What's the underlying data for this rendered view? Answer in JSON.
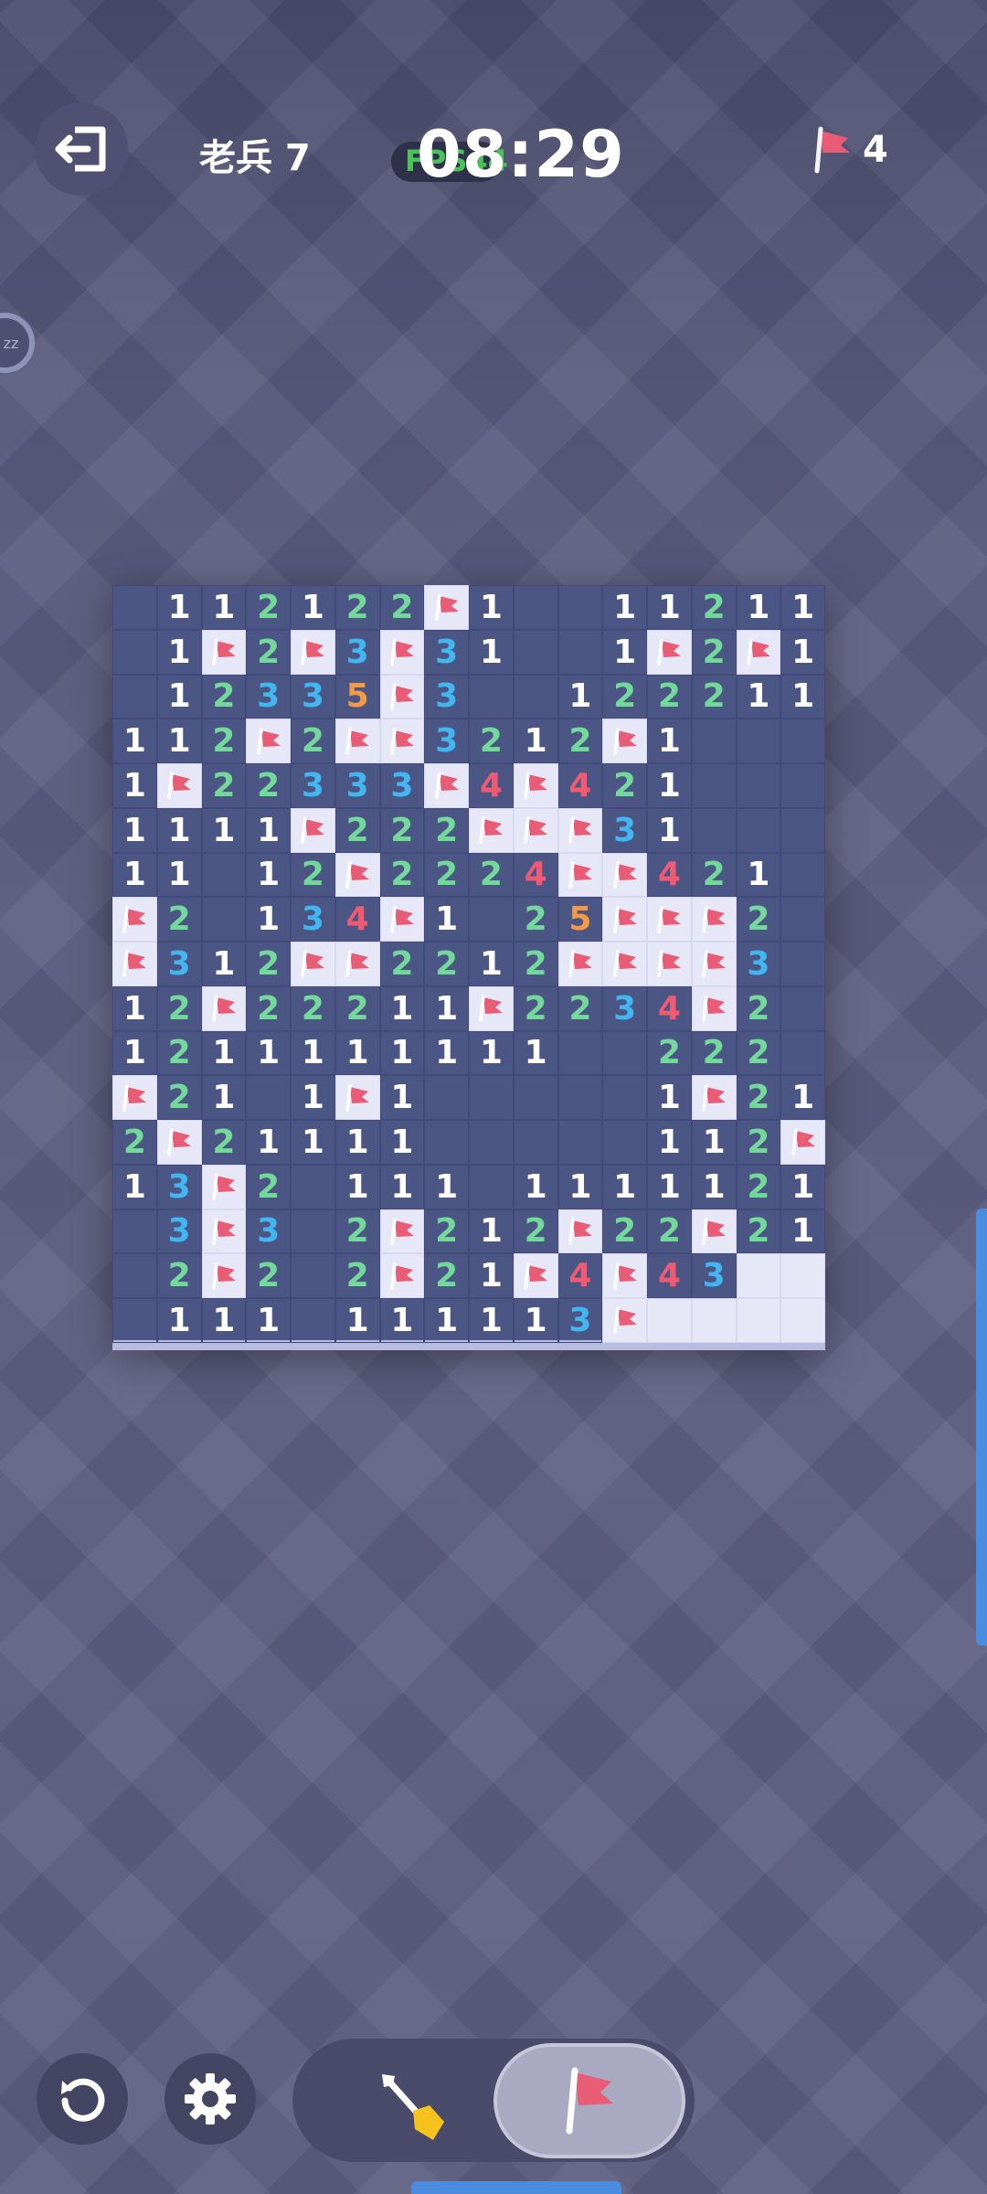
{
  "header": {
    "level_label": "老兵 7",
    "fps_label": "FPS44",
    "timer": "08:29",
    "flags_remaining": "4"
  },
  "side_badge_text": "zz",
  "board": {
    "rows": 17,
    "cols": 16,
    "legend": "digits = revealed count, F = flag, H = unrevealed, blank = empty",
    "colors": {
      "revealed": "#4c5684",
      "hidden": "#e6e8f8",
      "1": "#ffffff",
      "2": "#72d99a",
      "3": "#41b6f0",
      "4": "#f05a73",
      "5": "#f29a45",
      "flag": "#e85d75"
    },
    "cells": [
      [
        "",
        "1",
        "1",
        "2",
        "1",
        "2",
        "2",
        "F",
        "1",
        "",
        "",
        "1",
        "1",
        "2",
        "1",
        "1"
      ],
      [
        "",
        "1",
        "F",
        "2",
        "F",
        "3",
        "F",
        "3",
        "1",
        "",
        "",
        "1",
        "F",
        "2",
        "F",
        "1"
      ],
      [
        "",
        "1",
        "2",
        "3",
        "3",
        "5",
        "F",
        "3",
        "",
        "",
        "1",
        "2",
        "2",
        "2",
        "1",
        "1"
      ],
      [
        "1",
        "1",
        "2",
        "F",
        "2",
        "F",
        "F",
        "3",
        "2",
        "1",
        "2",
        "F",
        "1",
        "",
        "",
        ""
      ],
      [
        "1",
        "F",
        "2",
        "2",
        "3",
        "3",
        "3",
        "F",
        "4",
        "F",
        "4",
        "2",
        "1",
        "",
        "",
        ""
      ],
      [
        "1",
        "1",
        "1",
        "1",
        "F",
        "2",
        "2",
        "2",
        "F",
        "F",
        "F",
        "3",
        "1",
        "",
        "",
        ""
      ],
      [
        "1",
        "1",
        "",
        "1",
        "2",
        "F",
        "2",
        "2",
        "2",
        "4",
        "F",
        "F",
        "4",
        "2",
        "1",
        ""
      ],
      [
        "F",
        "2",
        "",
        "1",
        "3",
        "4",
        "F",
        "1",
        "",
        "2",
        "5",
        "F",
        "F",
        "F",
        "2",
        ""
      ],
      [
        "F",
        "3",
        "1",
        "2",
        "F",
        "F",
        "2",
        "2",
        "1",
        "2",
        "F",
        "F",
        "F",
        "F",
        "3",
        ""
      ],
      [
        "1",
        "2",
        "F",
        "2",
        "2",
        "2",
        "1",
        "1",
        "F",
        "2",
        "2",
        "3",
        "4",
        "F",
        "2",
        ""
      ],
      [
        "1",
        "2",
        "1",
        "1",
        "1",
        "1",
        "1",
        "1",
        "1",
        "1",
        "",
        "",
        "2",
        "2",
        "2",
        ""
      ],
      [
        "F",
        "2",
        "1",
        "",
        "1",
        "F",
        "1",
        "",
        "",
        "",
        "",
        "",
        "1",
        "F",
        "2",
        "1"
      ],
      [
        "2",
        "F",
        "2",
        "1",
        "1",
        "1",
        "1",
        "",
        "",
        "",
        "",
        "",
        "1",
        "1",
        "2",
        "F"
      ],
      [
        "1",
        "3",
        "F",
        "2",
        "",
        "1",
        "1",
        "1",
        "",
        "1",
        "1",
        "1",
        "1",
        "1",
        "2",
        "1"
      ],
      [
        "",
        "3",
        "F",
        "3",
        "",
        "2",
        "F",
        "2",
        "1",
        "2",
        "F",
        "2",
        "2",
        "F",
        "2",
        "1"
      ],
      [
        "",
        "2",
        "F",
        "2",
        "",
        "2",
        "F",
        "2",
        "1",
        "F",
        "4",
        "F",
        "4",
        "3",
        "H",
        "H"
      ],
      [
        "",
        "1",
        "1",
        "1",
        "",
        "1",
        "1",
        "1",
        "1",
        "1",
        "3",
        "F",
        "H",
        "H",
        "H",
        "H"
      ]
    ]
  },
  "toolbar": {
    "restart_icon": "restart-icon",
    "settings_icon": "gear-icon",
    "dig_icon": "shovel-icon",
    "flag_icon": "flag-icon",
    "active_mode": "flag"
  }
}
